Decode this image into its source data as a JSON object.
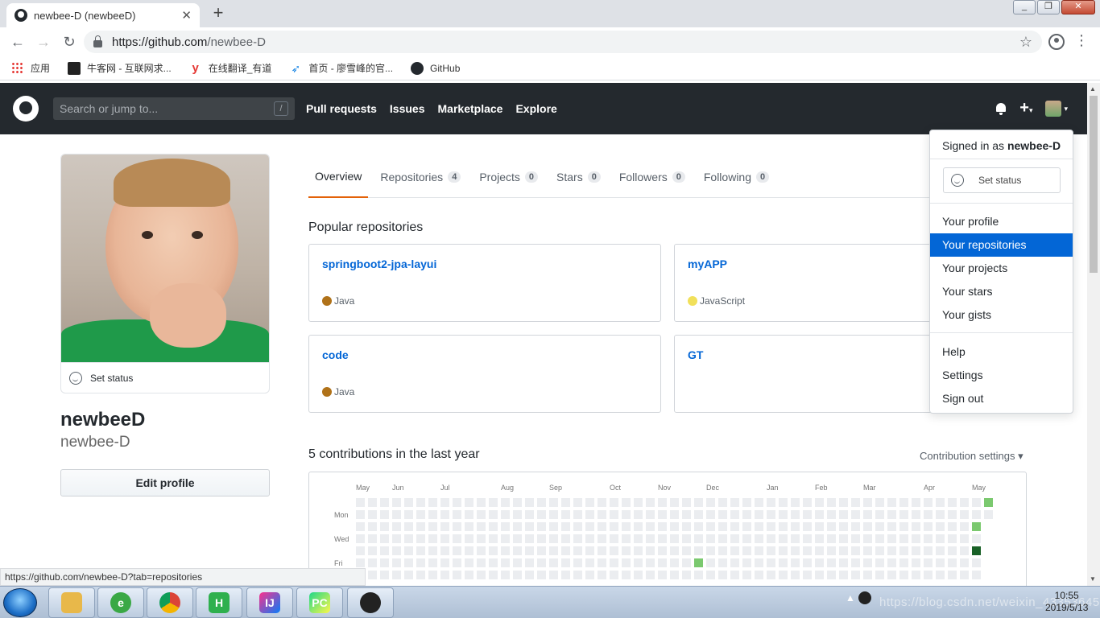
{
  "browser": {
    "tab_title": "newbee-D (newbeeD)",
    "tab_close": "✕",
    "new_tab": "+",
    "url_host": "https://github.com",
    "url_path": "/newbee-D",
    "bookmarks": [
      {
        "label": "应用",
        "icon": "apps-grid-icon"
      },
      {
        "label": "牛客网 - 互联网求...",
        "icon": "nowcoder-icon"
      },
      {
        "label": "在线翻译_有道",
        "icon": "youdao-icon"
      },
      {
        "label": "首页 - 廖雪峰的官...",
        "icon": "rocket-icon"
      },
      {
        "label": "GitHub",
        "icon": "github-icon"
      }
    ],
    "status_url": "https://github.com/newbee-D?tab=repositories"
  },
  "gh_header": {
    "search_placeholder": "Search or jump to...",
    "search_shortcut": "/",
    "nav": [
      "Pull requests",
      "Issues",
      "Marketplace",
      "Explore"
    ]
  },
  "profile": {
    "set_status": "Set status",
    "fullname": "newbeeD",
    "username": "newbee-D",
    "edit_profile": "Edit profile"
  },
  "tabs": [
    {
      "label": "Overview",
      "count": null,
      "selected": true
    },
    {
      "label": "Repositories",
      "count": "4"
    },
    {
      "label": "Projects",
      "count": "0"
    },
    {
      "label": "Stars",
      "count": "0"
    },
    {
      "label": "Followers",
      "count": "0"
    },
    {
      "label": "Following",
      "count": "0"
    }
  ],
  "popular": {
    "title": "Popular repositories",
    "repos": [
      {
        "name": "springboot2-jpa-layui",
        "lang": "Java",
        "color": "#b07219"
      },
      {
        "name": "myAPP",
        "lang": "JavaScript",
        "color": "#f1e05a"
      },
      {
        "name": "code",
        "lang": "Java",
        "color": "#b07219"
      },
      {
        "name": "GT",
        "lang": "",
        "color": ""
      }
    ]
  },
  "contributions": {
    "title": "5 contributions in the last year",
    "settings": "Contribution settings ▾",
    "months": [
      "May",
      "Jun",
      "Jul",
      "Aug",
      "Sep",
      "Oct",
      "Nov",
      "Dec",
      "Jan",
      "Feb",
      "Mar",
      "Apr",
      "May"
    ],
    "days": [
      "Mon",
      "Wed",
      "Fri"
    ],
    "colors": {
      "empty": "#ebedf0",
      "l1": "#7bc96f",
      "l3": "#196127"
    }
  },
  "dropdown": {
    "signed_prefix": "Signed in as ",
    "signed_user": "newbee-D",
    "set_status": "Set status",
    "items1": [
      "Your profile",
      "Your repositories",
      "Your projects",
      "Your stars",
      "Your gists"
    ],
    "items2": [
      "Help",
      "Settings",
      "Sign out"
    ],
    "highlighted": "Your repositories"
  },
  "taskbar": {
    "tray_text": "https://blog.csdn.net/weixin_43353645",
    "time": "10:55",
    "date": "2019/5/13"
  }
}
